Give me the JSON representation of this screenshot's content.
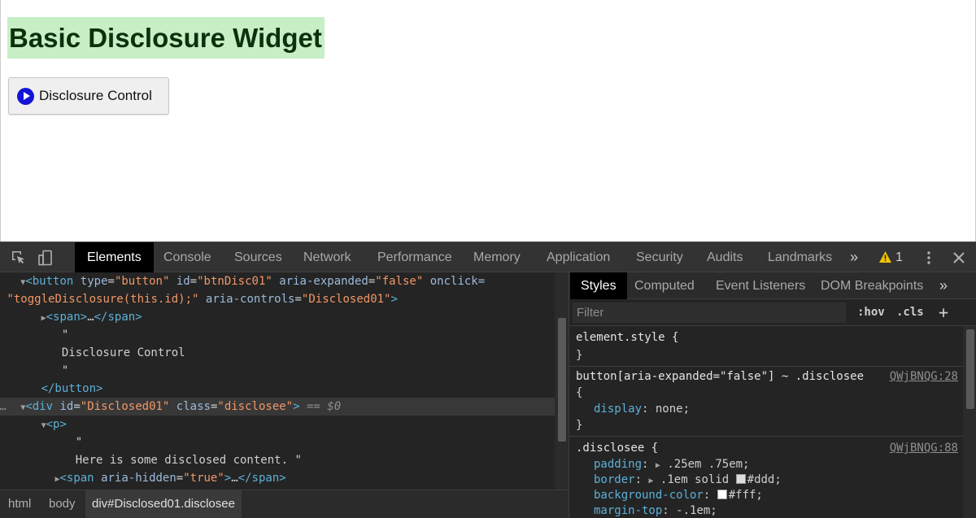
{
  "page": {
    "heading": "Basic Disclosure Widget",
    "button_label": "Disclosure Control",
    "heading_bg": "#c6efc6",
    "icon_color": "#1414d8"
  },
  "devtools": {
    "tabs": [
      "Elements",
      "Console",
      "Sources",
      "Network",
      "Performance",
      "Memory",
      "Application",
      "Security",
      "Audits",
      "Landmarks"
    ],
    "more_tabs": "»",
    "warning_count": "1",
    "elements": {
      "l1": {
        "tag_open": "<button",
        "a1": "type",
        "v1": "\"button\"",
        "a2": "id",
        "v2": "\"btnDisc01\"",
        "a3": "aria-expanded",
        "v3": "\"false\"",
        "a4": "onclick="
      },
      "l2": {
        "v4": "\"toggleDisclosure(this.id);\"",
        "a5": "aria-controls",
        "v5": "\"Disclosed01\"",
        "close": ">"
      },
      "l3": {
        "open": "<span>",
        "ell": "…",
        "close": "</span>"
      },
      "l4": "\"",
      "l5": "Disclosure Control",
      "l6": "\"",
      "l7": "</button>",
      "l8": {
        "dots": "…",
        "tag_open": "<div",
        "a1": "id",
        "v1": "\"Disclosed01\"",
        "a2": "class",
        "v2": "\"disclosee\"",
        "close": ">",
        "marker": "== $0"
      },
      "l9": "<p>",
      "l10": "\"",
      "l11": "Here is some disclosed content. \"",
      "l12": {
        "tag_open": "<span",
        "a1": "aria-hidden",
        "v1": "\"true\"",
        "close": ">",
        "ell": "…",
        "end": "</span>"
      }
    },
    "breadcrumb": [
      "html",
      "body",
      "div#Disclosed01.disclosee"
    ],
    "styles": {
      "tabs": [
        "Styles",
        "Computed",
        "Event Listeners",
        "DOM Breakpoints"
      ],
      "more_tabs": "»",
      "filter_placeholder": "Filter",
      "hov": ":hov",
      "cls": ".cls",
      "plus": "+",
      "rules": {
        "r1": {
          "selector": "element.style {",
          "close": "}"
        },
        "r2": {
          "selector": "button[aria-expanded=\"false\"] ~ .disclosee",
          "source": "QWjBNQG:28",
          "open": "{",
          "prop": "display",
          "value": "none;",
          "close": "}"
        },
        "r3": {
          "selector": ".disclosee {",
          "source": "QWjBNQG:88",
          "p1": "padding",
          "v1": ".25em .75em;",
          "p2": "border",
          "v2": ".1em solid",
          "v2c": "#ddd;",
          "p3": "background-color",
          "v3": "#fff;",
          "p4": "margin-top",
          "v4": "-.1em;"
        }
      }
    }
  }
}
